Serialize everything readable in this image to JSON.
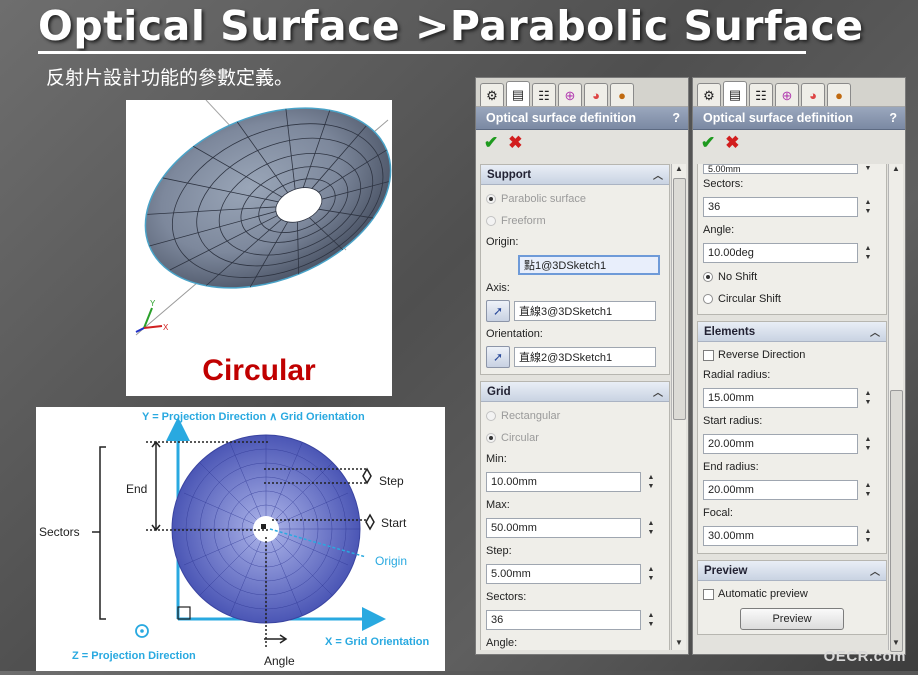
{
  "slide": {
    "title": "Optical Surface >Parabolic Surface",
    "subtitle": "反射片設計功能的參數定義。",
    "circular_label": "Circular",
    "watermark": "OECR.com"
  },
  "diagram": {
    "y_axis_label": "Y = Projection Direction ∧ Grid Orientation",
    "x_axis_label": "X = Grid Orientation",
    "z_label": "Z = Projection Direction",
    "end_label": "End",
    "sectors_label": "Sectors",
    "step_label": "Step",
    "start_label": "Start",
    "origin_label": "Origin",
    "angle_label": "Angle"
  },
  "left_panel": {
    "tabs": [
      "feature-icon",
      "property-icon",
      "config-icon",
      "target-icon",
      "appearance-icon",
      "sphere-icon"
    ],
    "header": "Optical surface definition",
    "help": "?",
    "ok": "✔",
    "cancel": "✖",
    "support": {
      "title": "Support",
      "opt_parabolic": "Parabolic surface",
      "opt_freeform": "Freeform",
      "origin_label": "Origin:",
      "origin_value": "點1@3DSketch1",
      "axis_label": "Axis:",
      "axis_value": "直線3@3DSketch1",
      "orientation_label": "Orientation:",
      "orientation_value": "直線2@3DSketch1"
    },
    "grid": {
      "title": "Grid",
      "opt_rectangular": "Rectangular",
      "opt_circular": "Circular",
      "min_label": "Min:",
      "min_value": "10.00mm",
      "max_label": "Max:",
      "max_value": "50.00mm",
      "step_label": "Step:",
      "step_value": "5.00mm",
      "sectors_label": "Sectors:",
      "sectors_value": "36",
      "angle_label": "Angle:"
    }
  },
  "right_panel": {
    "header": "Optical surface definition",
    "help": "?",
    "ok": "✔",
    "cancel": "✖",
    "top_partial_value": "5.00mm",
    "sectors_label": "Sectors:",
    "sectors_value": "36",
    "angle_label": "Angle:",
    "angle_value": "10.00deg",
    "no_shift": "No Shift",
    "circular_shift": "Circular Shift",
    "elements": {
      "title": "Elements",
      "reverse_direction": "Reverse Direction",
      "radial_radius_label": "Radial radius:",
      "radial_radius_value": "15.00mm",
      "start_radius_label": "Start radius:",
      "start_radius_value": "20.00mm",
      "end_radius_label": "End radius:",
      "end_radius_value": "20.00mm",
      "focal_label": "Focal:",
      "focal_value": "30.00mm"
    },
    "preview": {
      "title": "Preview",
      "automatic_preview": "Automatic preview",
      "preview_button": "Preview"
    }
  }
}
